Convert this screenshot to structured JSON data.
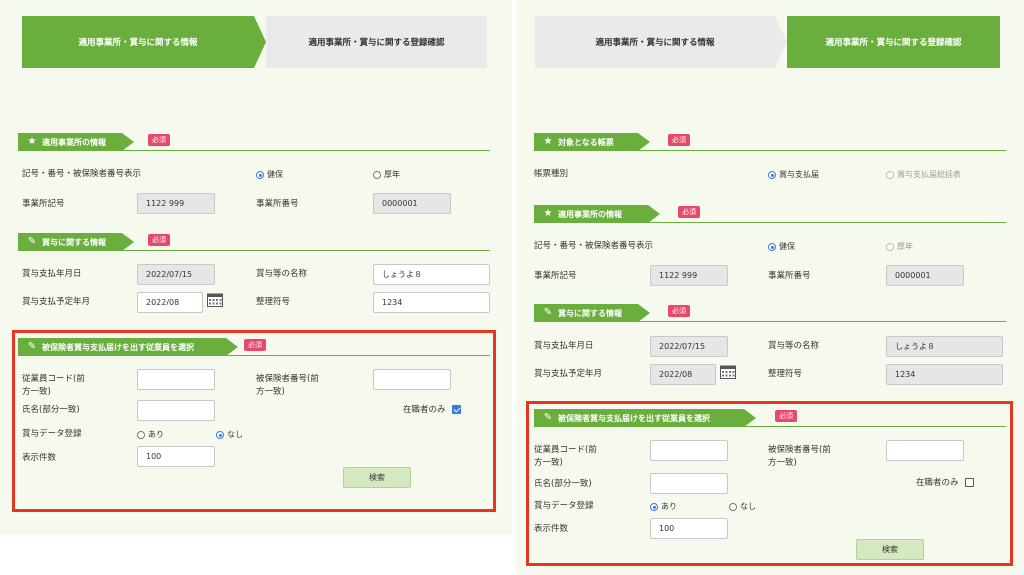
{
  "left": {
    "steps": {
      "step1": "適用事業所・賞与に関する情報",
      "step2": "適用事業所・賞与に関する登録確認"
    },
    "office_section": {
      "title": "適用事業所の情報",
      "required": "必須",
      "symbol_label": "記号・番号・被保険者番号表示",
      "radio_kenpo": "健保",
      "radio_kounen": "厚年",
      "office_symbol_label": "事業所記号",
      "office_symbol_value": "1122 999",
      "office_number_label": "事業所番号",
      "office_number_value": "0000001"
    },
    "bonus_section": {
      "title": "賞与に関する情報",
      "required": "必須",
      "pay_date_label": "賞与支払年月日",
      "pay_date_value": "2022/07/15",
      "name_label": "賞与等の名称",
      "name_value": "しょうよ８",
      "planned_label": "賞与支払予定年月",
      "planned_value": "2022/08",
      "ref_label": "整理符号",
      "ref_value": "1234"
    },
    "employee_section": {
      "title": "被保険者賞与支払届けを出す従業員を選択",
      "required": "必須",
      "emp_code_label_1": "従業員コード(前",
      "emp_code_label_2": "方一致)",
      "ins_no_label_1": "被保険者番号(前",
      "ins_no_label_2": "方一致)",
      "name_label": "氏名(部分一致)",
      "employed_only_label": "在職者のみ",
      "bonus_data_label": "賞与データ登録",
      "radio_yes": "あり",
      "radio_no": "なし",
      "count_label": "表示件数",
      "count_value": "100",
      "search_button": "検索"
    }
  },
  "right": {
    "steps": {
      "step1": "適用事業所・賞与に関する情報",
      "step2": "適用事業所・賞与に関する登録確認"
    },
    "form_section": {
      "title": "対象となる帳票",
      "required": "必須",
      "form_type_label": "帳票種別",
      "radio_pay": "賞与支払届",
      "radio_summary": "賞与支払届総括表"
    },
    "office_section": {
      "title": "適用事業所の情報",
      "required": "必須",
      "symbol_label": "記号・番号・被保険者番号表示",
      "radio_kenpo": "健保",
      "radio_kounen": "厚年",
      "office_symbol_label": "事業所記号",
      "office_symbol_value": "1122 999",
      "office_number_label": "事業所番号",
      "office_number_value": "0000001"
    },
    "bonus_section": {
      "title": "賞与に関する情報",
      "required": "必須",
      "pay_date_label": "賞与支払年月日",
      "pay_date_value": "2022/07/15",
      "name_label": "賞与等の名称",
      "name_value": "しょうよ８",
      "planned_label": "賞与支払予定年月",
      "planned_value": "2022/08",
      "ref_label": "整理符号",
      "ref_value": "1234"
    },
    "employee_section": {
      "title": "被保険者賞与支払届けを出す従業員を選択",
      "required": "必須",
      "emp_code_label_1": "従業員コード(前",
      "emp_code_label_2": "方一致)",
      "ins_no_label_1": "被保険者番号(前",
      "ins_no_label_2": "方一致)",
      "name_label": "氏名(部分一致)",
      "employed_only_label": "在職者のみ",
      "bonus_data_label": "賞与データ登録",
      "radio_yes": "あり",
      "radio_no": "なし",
      "count_label": "表示件数",
      "count_value": "100",
      "search_button": "検索"
    }
  },
  "colors": {
    "green": "#6aaf3d",
    "required": "#e8486a",
    "highlight": "#e8351f",
    "panel_bg": "#f6faee"
  },
  "icons": {
    "star": "star-icon",
    "pencil": "pencil-icon",
    "calendar": "calendar-icon"
  }
}
